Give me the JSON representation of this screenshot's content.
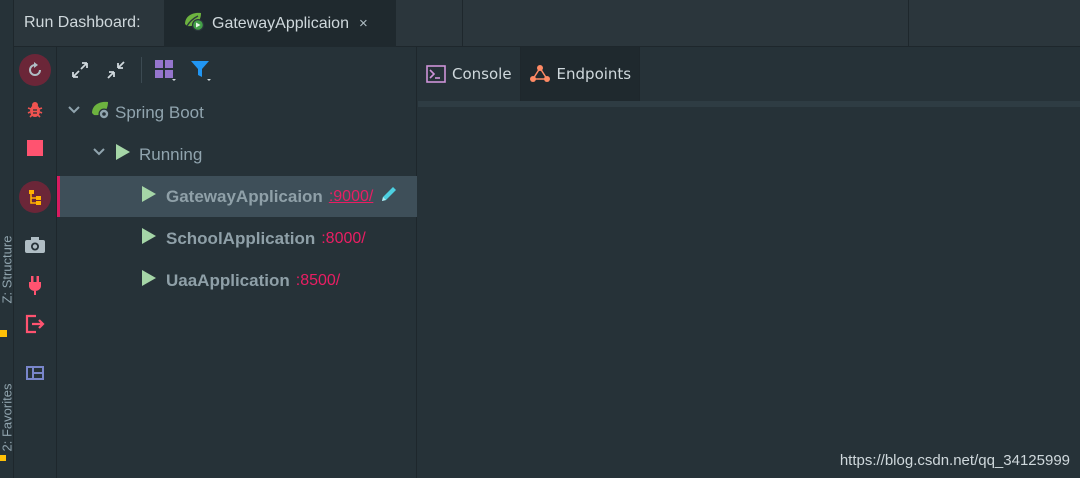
{
  "header": {
    "title": "Run Dashboard:",
    "tab": {
      "label": "GatewayApplicaion",
      "close": "×"
    }
  },
  "edge": {
    "structure": "Z: Structure",
    "favorites": "2: Favorites"
  },
  "tree": {
    "root": "Spring Boot",
    "group": "Running",
    "apps": [
      {
        "name": "GatewayApplicaion",
        "port": ":9000/"
      },
      {
        "name": "SchoolApplication",
        "port": ":8000/"
      },
      {
        "name": "UaaApplication",
        "port": ":8500/"
      }
    ]
  },
  "right": {
    "tabs": [
      {
        "label": "Console"
      },
      {
        "label": "Endpoints"
      }
    ]
  },
  "watermark": "https://blog.csdn.net/qq_34125999",
  "colors": {
    "accent": "#e91e63",
    "play": "#a5d6a7",
    "spring": "#6db33f",
    "filter": "#2196f3"
  }
}
